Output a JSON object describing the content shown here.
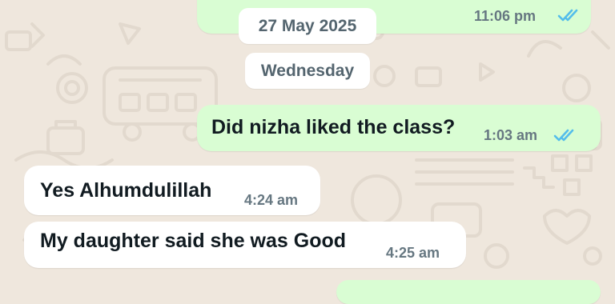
{
  "date_chips": {
    "date": "27 May 2025",
    "weekday": "Wednesday"
  },
  "messages": [
    {
      "direction": "outgoing",
      "text": "",
      "time": "11:06 pm",
      "status": "read"
    },
    {
      "direction": "outgoing",
      "text": "Did nizha liked the class?",
      "time": "1:03 am",
      "status": "read"
    },
    {
      "direction": "incoming",
      "text": "Yes Alhumdulillah",
      "time": "4:24 am"
    },
    {
      "direction": "incoming",
      "text": "My daughter said she was Good",
      "time": "4:25 am"
    }
  ],
  "colors": {
    "background": "#efe7dd",
    "outgoing_bubble": "#d9fdd3",
    "incoming_bubble": "#ffffff",
    "read_ticks": "#53bdeb"
  }
}
